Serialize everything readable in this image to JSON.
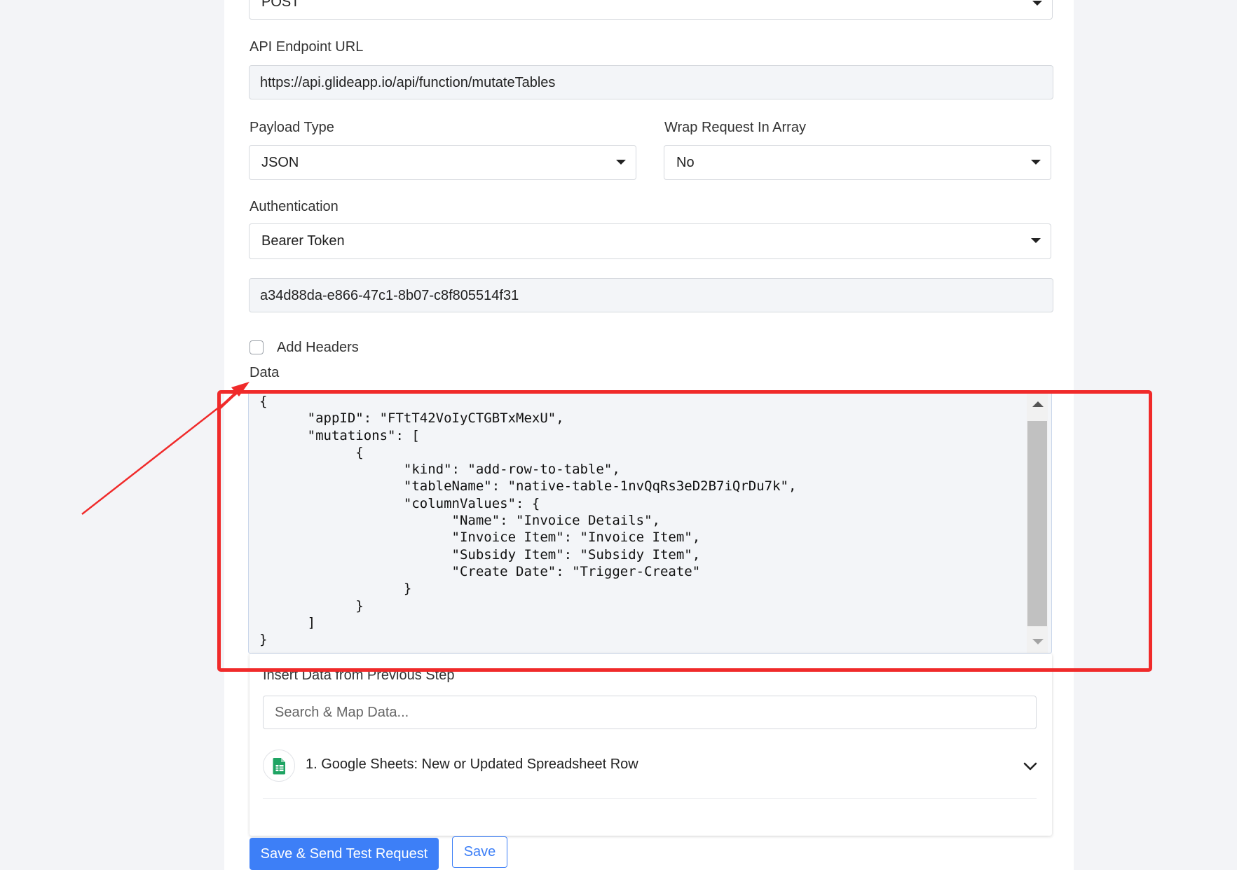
{
  "method": {
    "value": "POST"
  },
  "endpoint": {
    "label": "API Endpoint URL",
    "value": "https://api.glideapp.io/api/function/mutateTables"
  },
  "payload_type": {
    "label": "Payload Type",
    "value": "JSON"
  },
  "wrap_request": {
    "label": "Wrap Request In Array",
    "value": "No"
  },
  "authentication": {
    "label": "Authentication",
    "value": "Bearer Token"
  },
  "token": {
    "value": "a34d88da-e866-47c1-8b07-c8f805514f31"
  },
  "headers": {
    "label": "Add Headers",
    "checked": false
  },
  "data": {
    "label": "Data",
    "body": "{\n      \"appID\": \"FTtT42VoIyCTGBTxMexU\",\n      \"mutations\": [\n            {\n                  \"kind\": \"add-row-to-table\",\n                  \"tableName\": \"native-table-1nvQqRs3eD2B7iQrDu7k\",\n                  \"columnValues\": {\n                        \"Name\": \"Invoice Details\",\n                        \"Invoice Item\": \"Invoice Item\",\n                        \"Subsidy Item\": \"Subsidy Item\",\n                        \"Create Date\": \"Trigger-Create\"\n                  }\n            }\n      ]\n}"
  },
  "insert_data": {
    "title": "Insert Data from Previous Step",
    "search_placeholder": "Search & Map Data...",
    "step_label": "1. Google Sheets: New or Updated Spreadsheet Row"
  },
  "buttons": {
    "save_send": "Save & Send Test Request",
    "save": "Save"
  },
  "colors": {
    "accent": "#3d7ff7",
    "annotation": "#f02a2a",
    "sheets_green": "#1fa463"
  },
  "icons": [
    "caret-down-icon",
    "google-sheets-icon",
    "chevron-down-icon",
    "scroll-up-icon",
    "scroll-down-icon"
  ]
}
